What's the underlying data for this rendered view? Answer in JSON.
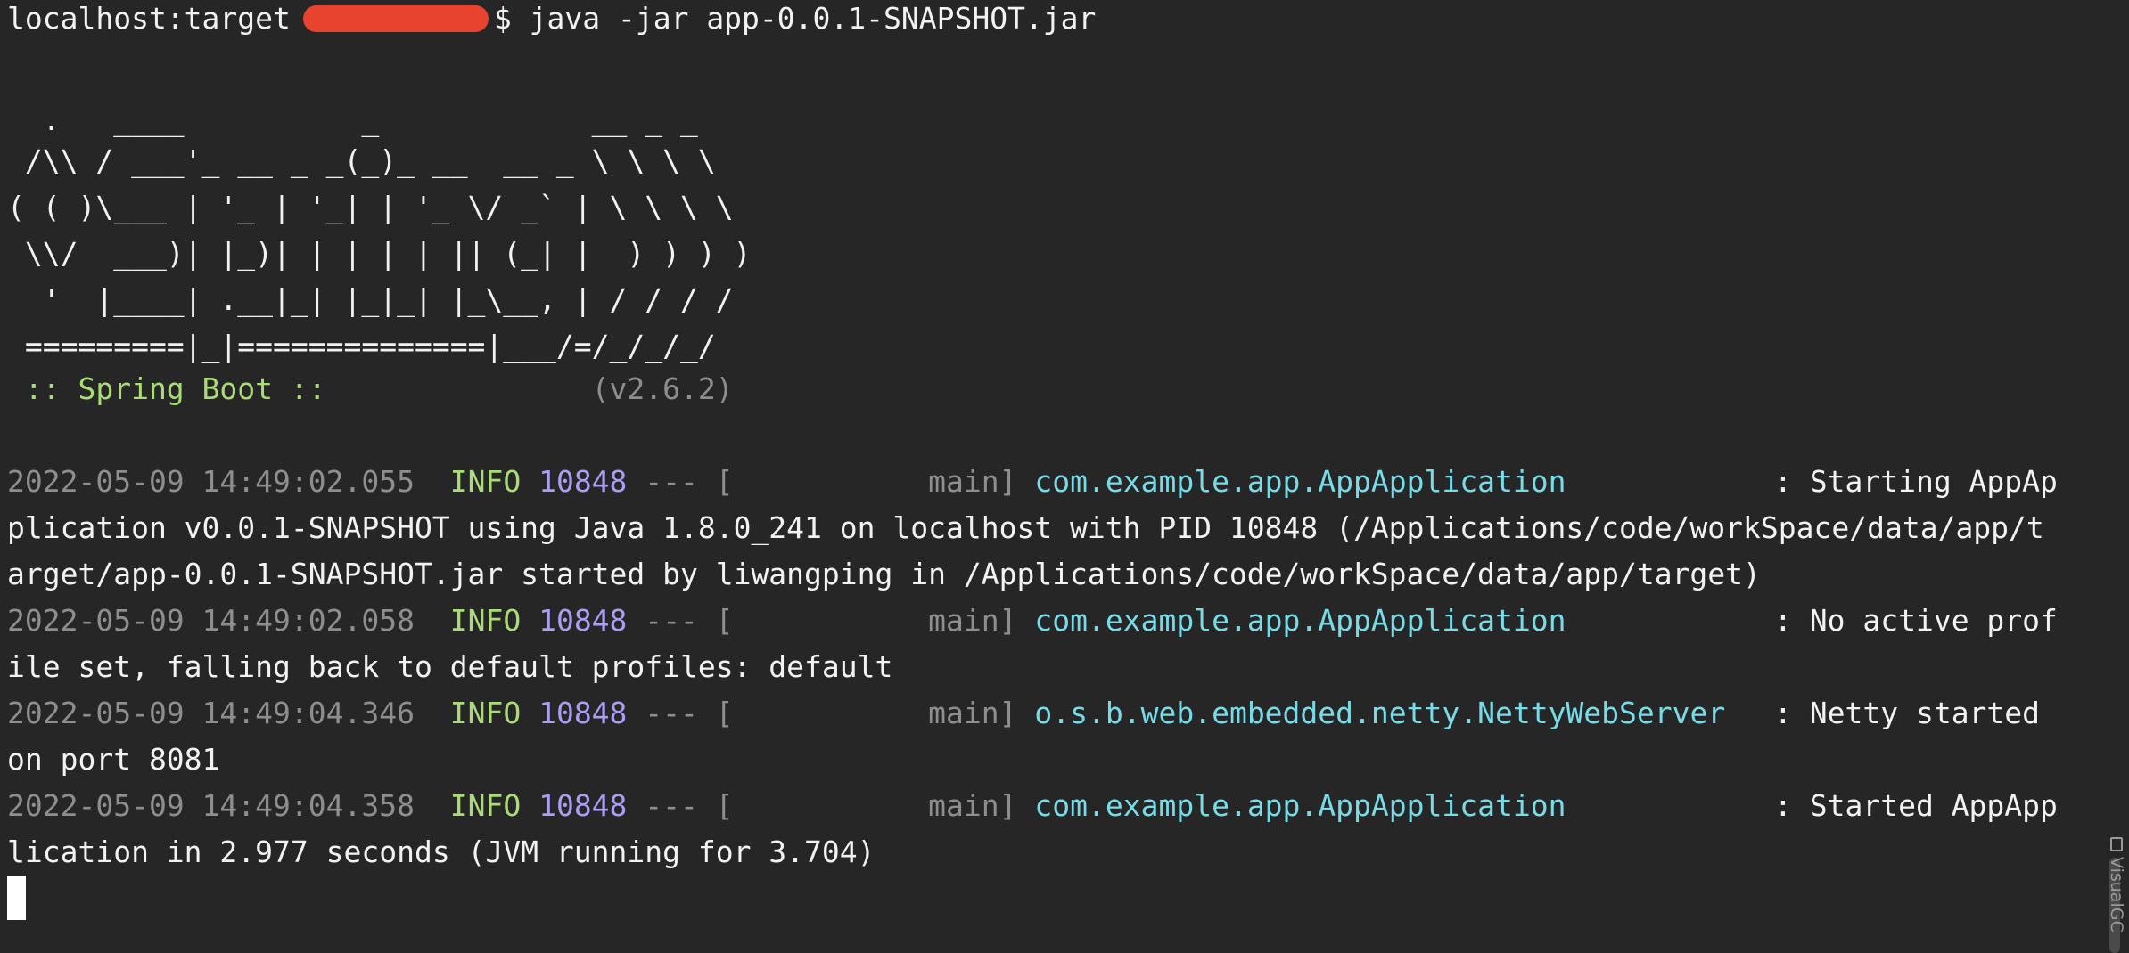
{
  "prompt": {
    "host_dir": "localhost:target",
    "symbol": "$",
    "command": "java -jar app-0.0.1-SNAPSHOT.jar"
  },
  "banner": {
    "art": [
      "  .   ____          _            __ _ _",
      " /\\\\ / ___'_ __ _ _(_)_ __  __ _ \\ \\ \\ \\",
      "( ( )\\___ | '_ | '_| | '_ \\/ _` | \\ \\ \\ \\",
      " \\\\/  ___)| |_)| | | | | || (_| |  ) ) ) )",
      "  '  |____| .__|_| |_|_| |_\\__, | / / / /",
      " =========|_|==============|___/=/_/_/_/"
    ],
    "tagline": " :: Spring Boot :: ",
    "version_pad": "              ",
    "version": "(v2.6.2)"
  },
  "log": {
    "entries": [
      {
        "timestamp": "2022-05-09 14:49:02.055",
        "level": "INFO",
        "pid": "10848",
        "sep": "--- [",
        "thread": "           main]",
        "logger": "com.example.app.AppApplication",
        "colon": ": ",
        "msg_first": "Starting AppAp",
        "msg_cont": [
          "plication v0.0.1-SNAPSHOT using Java 1.8.0_241 on localhost with PID 10848 (/Applications/code/workSpace/data/app/t",
          "arget/app-0.0.1-SNAPSHOT.jar started by liwangping in /Applications/code/workSpace/data/app/target)"
        ]
      },
      {
        "timestamp": "2022-05-09 14:49:02.058",
        "level": "INFO",
        "pid": "10848",
        "sep": "--- [",
        "thread": "           main]",
        "logger": "com.example.app.AppApplication",
        "colon": ": ",
        "msg_first": "No active prof",
        "msg_cont": [
          "ile set, falling back to default profiles: default"
        ]
      },
      {
        "timestamp": "2022-05-09 14:49:04.346",
        "level": "INFO",
        "pid": "10848",
        "sep": "--- [",
        "thread": "           main]",
        "logger": "o.s.b.web.embedded.netty.NettyWebServer",
        "colon": ": ",
        "msg_first": "Netty started",
        "msg_cont": [
          "on port 8081"
        ]
      },
      {
        "timestamp": "2022-05-09 14:49:04.358",
        "level": "INFO",
        "pid": "10848",
        "sep": "--- [",
        "thread": "           main]",
        "logger": "com.example.app.AppApplication",
        "colon": ": ",
        "msg_first": "Started AppApp",
        "msg_cont": [
          "lication in 2.977 seconds (JVM running for 3.704)"
        ]
      }
    ]
  },
  "side_panel": {
    "label": "VisualGC"
  },
  "colors": {
    "background": "#262626",
    "text": "#f2f2f2",
    "dim": "#8e8e8e",
    "green": "#a9dc76",
    "purple": "#ab9df2",
    "cyan": "#78dce8",
    "redaction": "#e8432e"
  },
  "icons": {
    "visualgc": "visualgc-icon"
  }
}
